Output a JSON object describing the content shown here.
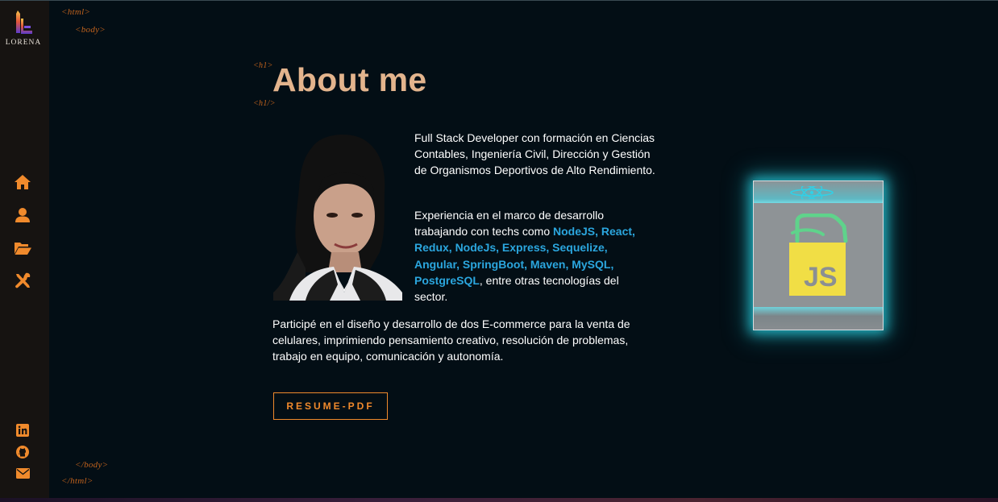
{
  "brand": {
    "name": "LORENA",
    "logo_icon": "logo-icon"
  },
  "tags": {
    "html_open": "<html>",
    "body_open": "<body>",
    "h1_open": "<h1>",
    "h1_close": "<h1/>",
    "body_close": "</body>",
    "html_close": "</html>"
  },
  "nav": [
    {
      "name": "home",
      "icon": "home-icon"
    },
    {
      "name": "about",
      "icon": "user-icon"
    },
    {
      "name": "portfolio",
      "icon": "folder-open-icon"
    },
    {
      "name": "skills",
      "icon": "tools-icon"
    }
  ],
  "social": [
    {
      "name": "linkedin",
      "icon": "linkedin-icon"
    },
    {
      "name": "github",
      "icon": "github-icon"
    },
    {
      "name": "email",
      "icon": "envelope-icon"
    }
  ],
  "about": {
    "title": "About me",
    "p1": "Full Stack Developer con formación en Ciencias Contables, Ingeniería Civil, Dirección y Gestión de Organismos Deportivos de Alto Rendimiento.",
    "p2_before": "Experiencia en el marco de desarrollo trabajando con techs como ",
    "p2_techs": "NodeJS, React, Redux, NodeJs, Express, Sequelize, Angular, SpringBoot, Maven, MySQL, PostgreSQL",
    "p2_after": ", entre otras tecnologías del sector.",
    "p3": "Participé en el diseño y desarrollo de dos E-commerce para la venta de celulares, imprimiendo pensamiento creativo, resolución de problemas, trabajo en equipo, comunicación y autonomía.",
    "resume_button": "RESUME-PDF"
  },
  "cube": {
    "top_icon": "react-icon",
    "front_icon": "javascript-icon",
    "front_label": "JS",
    "glow_color": "#28d2e1"
  },
  "colors": {
    "accent": "#f08a2c",
    "title": "#e3b48d",
    "tech_link": "#2ba6de",
    "background": "#030e15",
    "sidebar": "#161311"
  }
}
